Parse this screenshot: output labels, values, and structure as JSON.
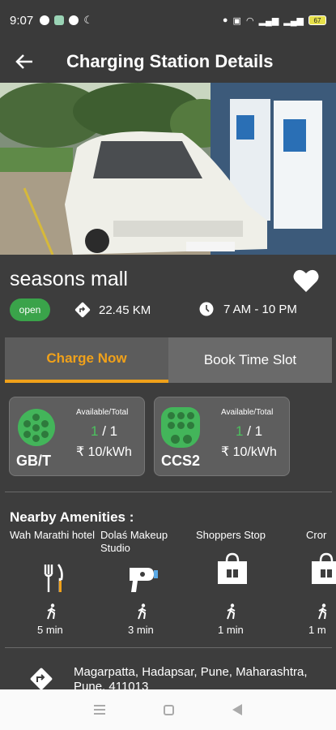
{
  "status_bar": {
    "time": "9:07",
    "battery": "67"
  },
  "app_bar": {
    "title": "Charging Station Details"
  },
  "station": {
    "name": "seasons mall",
    "status": "open",
    "distance": "22.45 KM",
    "hours": "7 AM - 10 PM"
  },
  "tabs": [
    {
      "label": "Charge Now",
      "active": true
    },
    {
      "label": "Book Time Slot",
      "active": false
    }
  ],
  "connectors": [
    {
      "type": "GB/T",
      "avail_label": "Available/Total",
      "available": "1",
      "total": "/ 1",
      "price": "₹ 10/kWh"
    },
    {
      "type": "CCS2",
      "avail_label": "Available/Total",
      "available": "1",
      "total": "/ 1",
      "price": "₹ 10/kWh"
    }
  ],
  "amenities": {
    "title": "Nearby Amenities :",
    "items": [
      {
        "name": "Wah Marathi hotel",
        "icon": "restaurant-icon",
        "time": "5 min"
      },
      {
        "name": "Dolaś Makeup Studio",
        "icon": "hair-dryer-icon",
        "time": "3 min"
      },
      {
        "name": "Shoppers Stop",
        "icon": "shopping-bag-icon",
        "time": "1 min"
      },
      {
        "name": "Cror",
        "icon": "shopping-bag-icon",
        "time": "1 m"
      }
    ]
  },
  "address": {
    "text": "Magarpatta, Hadapsar, Pune, Maharashtra, Pune, 411013"
  },
  "colors": {
    "accent": "#f0a11a",
    "green": "#43b55a",
    "background": "#3d3d3d"
  }
}
